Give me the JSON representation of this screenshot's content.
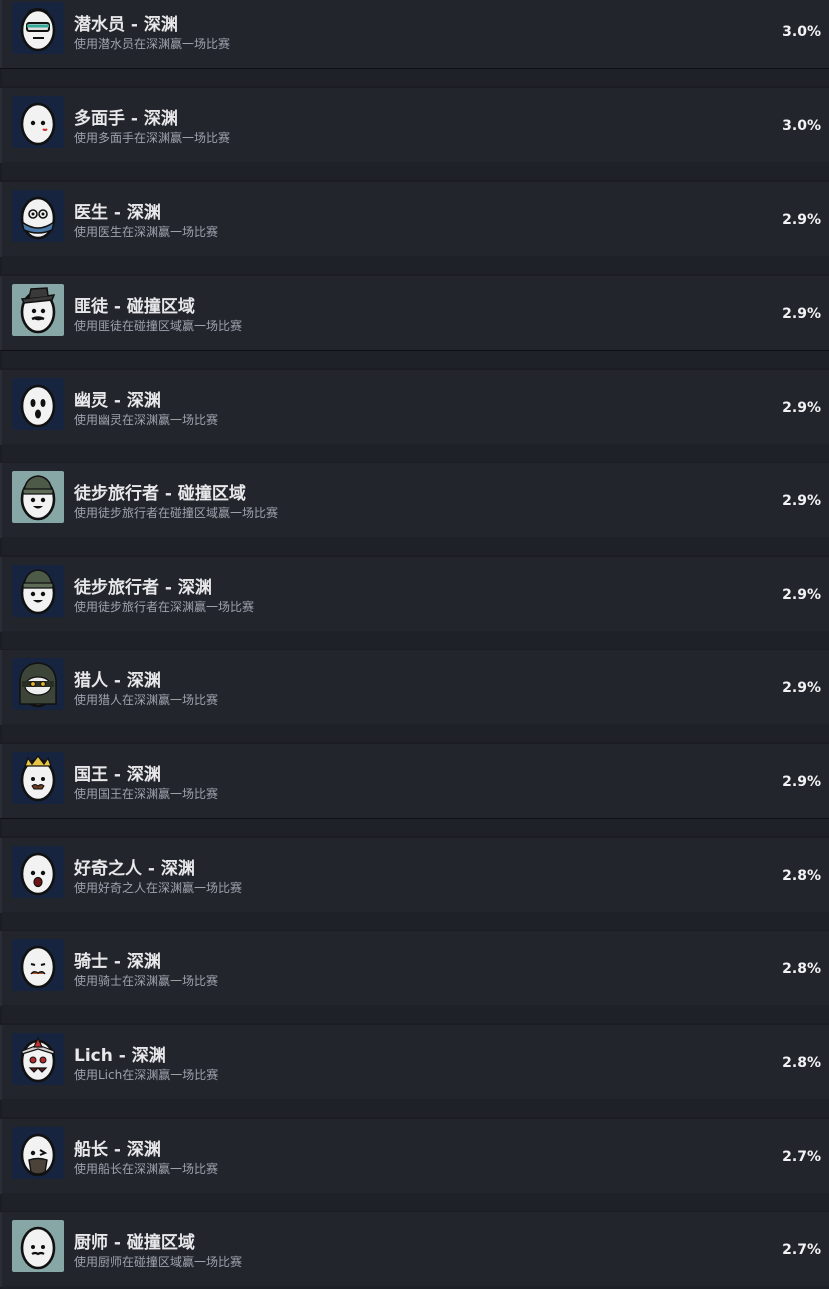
{
  "achievements": [
    {
      "title": "潜水员 - 深渊",
      "description": "使用潜水员在深渊赢一场比赛",
      "percent": "3.0%",
      "icon": "diver-egg-icon",
      "icon_bg": "#1a2a4a",
      "accessory": "goggles"
    },
    {
      "title": "多面手 - 深渊",
      "description": "使用多面手在深渊赢一场比赛",
      "percent": "3.0%",
      "icon": "generalist-egg-icon",
      "icon_bg": "#1a2a4a",
      "accessory": "plain"
    },
    {
      "title": "医生 - 深渊",
      "description": "使用医生在深渊赢一场比赛",
      "percent": "2.9%",
      "icon": "doctor-egg-icon",
      "icon_bg": "#1a2a4a",
      "accessory": "mask"
    },
    {
      "title": "匪徒 - 碰撞区域",
      "description": "使用匪徒在碰撞区域赢一场比赛",
      "percent": "2.9%",
      "icon": "bandit-egg-icon",
      "icon_bg": "#7fa0a0",
      "accessory": "hat"
    },
    {
      "title": "幽灵 - 深渊",
      "description": "使用幽灵在深渊赢一场比赛",
      "percent": "2.9%",
      "icon": "ghost-egg-icon",
      "icon_bg": "#1a2a4a",
      "accessory": "ghost"
    },
    {
      "title": "徒步旅行者 - 碰撞区域",
      "description": "使用徒步旅行者在碰撞区域赢一场比赛",
      "percent": "2.9%",
      "icon": "hiker-egg-icon",
      "icon_bg": "#7fa0a0",
      "accessory": "beanie"
    },
    {
      "title": "徒步旅行者 - 深渊",
      "description": "使用徒步旅行者在深渊赢一场比赛",
      "percent": "2.9%",
      "icon": "hiker-egg-icon",
      "icon_bg": "#1a2a4a",
      "accessory": "beanie"
    },
    {
      "title": "猎人 - 深渊",
      "description": "使用猎人在深渊赢一场比赛",
      "percent": "2.9%",
      "icon": "hunter-egg-icon",
      "icon_bg": "#1a2a4a",
      "accessory": "hood"
    },
    {
      "title": "国王 - 深渊",
      "description": "使用国王在深渊赢一场比赛",
      "percent": "2.9%",
      "icon": "king-egg-icon",
      "icon_bg": "#1a2a4a",
      "accessory": "crown"
    },
    {
      "title": "好奇之人 - 深渊",
      "description": "使用好奇之人在深渊赢一场比赛",
      "percent": "2.8%",
      "icon": "curious-egg-icon",
      "icon_bg": "#1a2a4a",
      "accessory": "surprised"
    },
    {
      "title": "骑士 - 深渊",
      "description": "使用骑士在深渊赢一场比赛",
      "percent": "2.8%",
      "icon": "knight-egg-icon",
      "icon_bg": "#1a2a4a",
      "accessory": "mustache"
    },
    {
      "title": "Lich - 深渊",
      "description": "使用Lich在深渊赢一场比赛",
      "percent": "2.8%",
      "icon": "lich-egg-icon",
      "icon_bg": "#1a2a4a",
      "accessory": "lich"
    },
    {
      "title": "船长 - 深渊",
      "description": "使用船长在深渊赢一场比赛",
      "percent": "2.7%",
      "icon": "captain-egg-icon",
      "icon_bg": "#1a2a4a",
      "accessory": "beard"
    },
    {
      "title": "厨师 - 碰撞区域",
      "description": "使用厨师在碰撞区域赢一场比赛",
      "percent": "2.7%",
      "icon": "chef-egg-icon",
      "icon_bg": "#7fa0a0",
      "accessory": "mustache-small"
    }
  ]
}
